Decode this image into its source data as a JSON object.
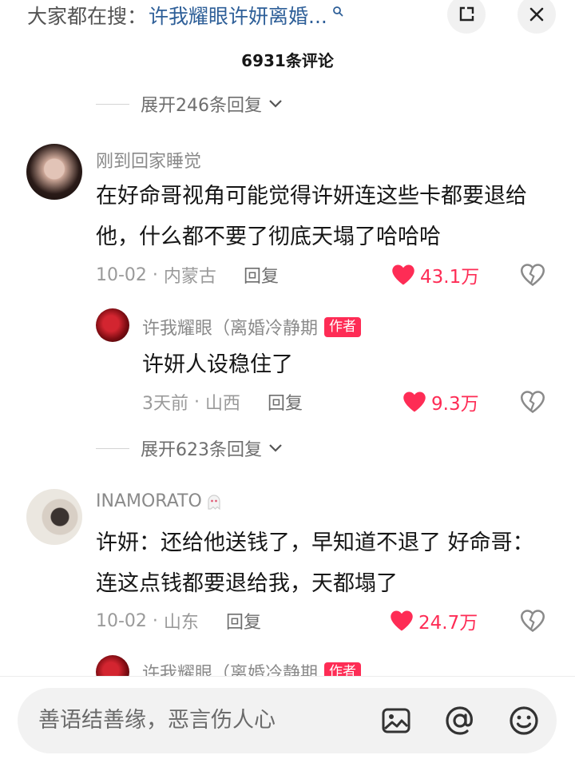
{
  "header": {
    "search_prefix": "大家都在搜：",
    "search_keyword": "许我耀眼许妍离婚...",
    "icons": [
      "search-icon",
      "expand-icon",
      "close-icon"
    ]
  },
  "comment_count": "6931条评论",
  "expand_replies_top": "展开246条回复",
  "comments": [
    {
      "username": "刚到回家睡觉",
      "text": "在好命哥视角可能觉得许妍连这些卡都要退给他，什么都不要了彻底天塌了哈哈哈",
      "date": "10-02",
      "location": "内蒙古",
      "reply_label": "回复",
      "likes": "43.1万",
      "liked": true
    },
    {
      "username": "许我耀眼（离婚冷静期",
      "author_badge": "作者",
      "text": "许妍人设稳住了",
      "date": "3天前",
      "location": "山西",
      "reply_label": "回复",
      "likes": "9.3万",
      "liked": true
    },
    {
      "username": "INAMORATO",
      "text": "许妍：还给他送钱了，早知道不退了 好命哥：连这点钱都要退给我，天都塌了",
      "date": "10-02",
      "location": "山东",
      "reply_label": "回复",
      "likes": "24.7万",
      "liked": true
    },
    {
      "username": "许我耀眼（离婚冷静期",
      "author_badge": "作者"
    }
  ],
  "expand_replies_mid": "展开623条回复",
  "composer": {
    "placeholder": "善语结善缘，恶言伤人心",
    "icons": [
      "image-icon",
      "mention-icon",
      "emoji-icon"
    ]
  },
  "colors": {
    "accent": "#fe2c55",
    "link": "#2e5f98",
    "muted": "#9a9a9a"
  }
}
